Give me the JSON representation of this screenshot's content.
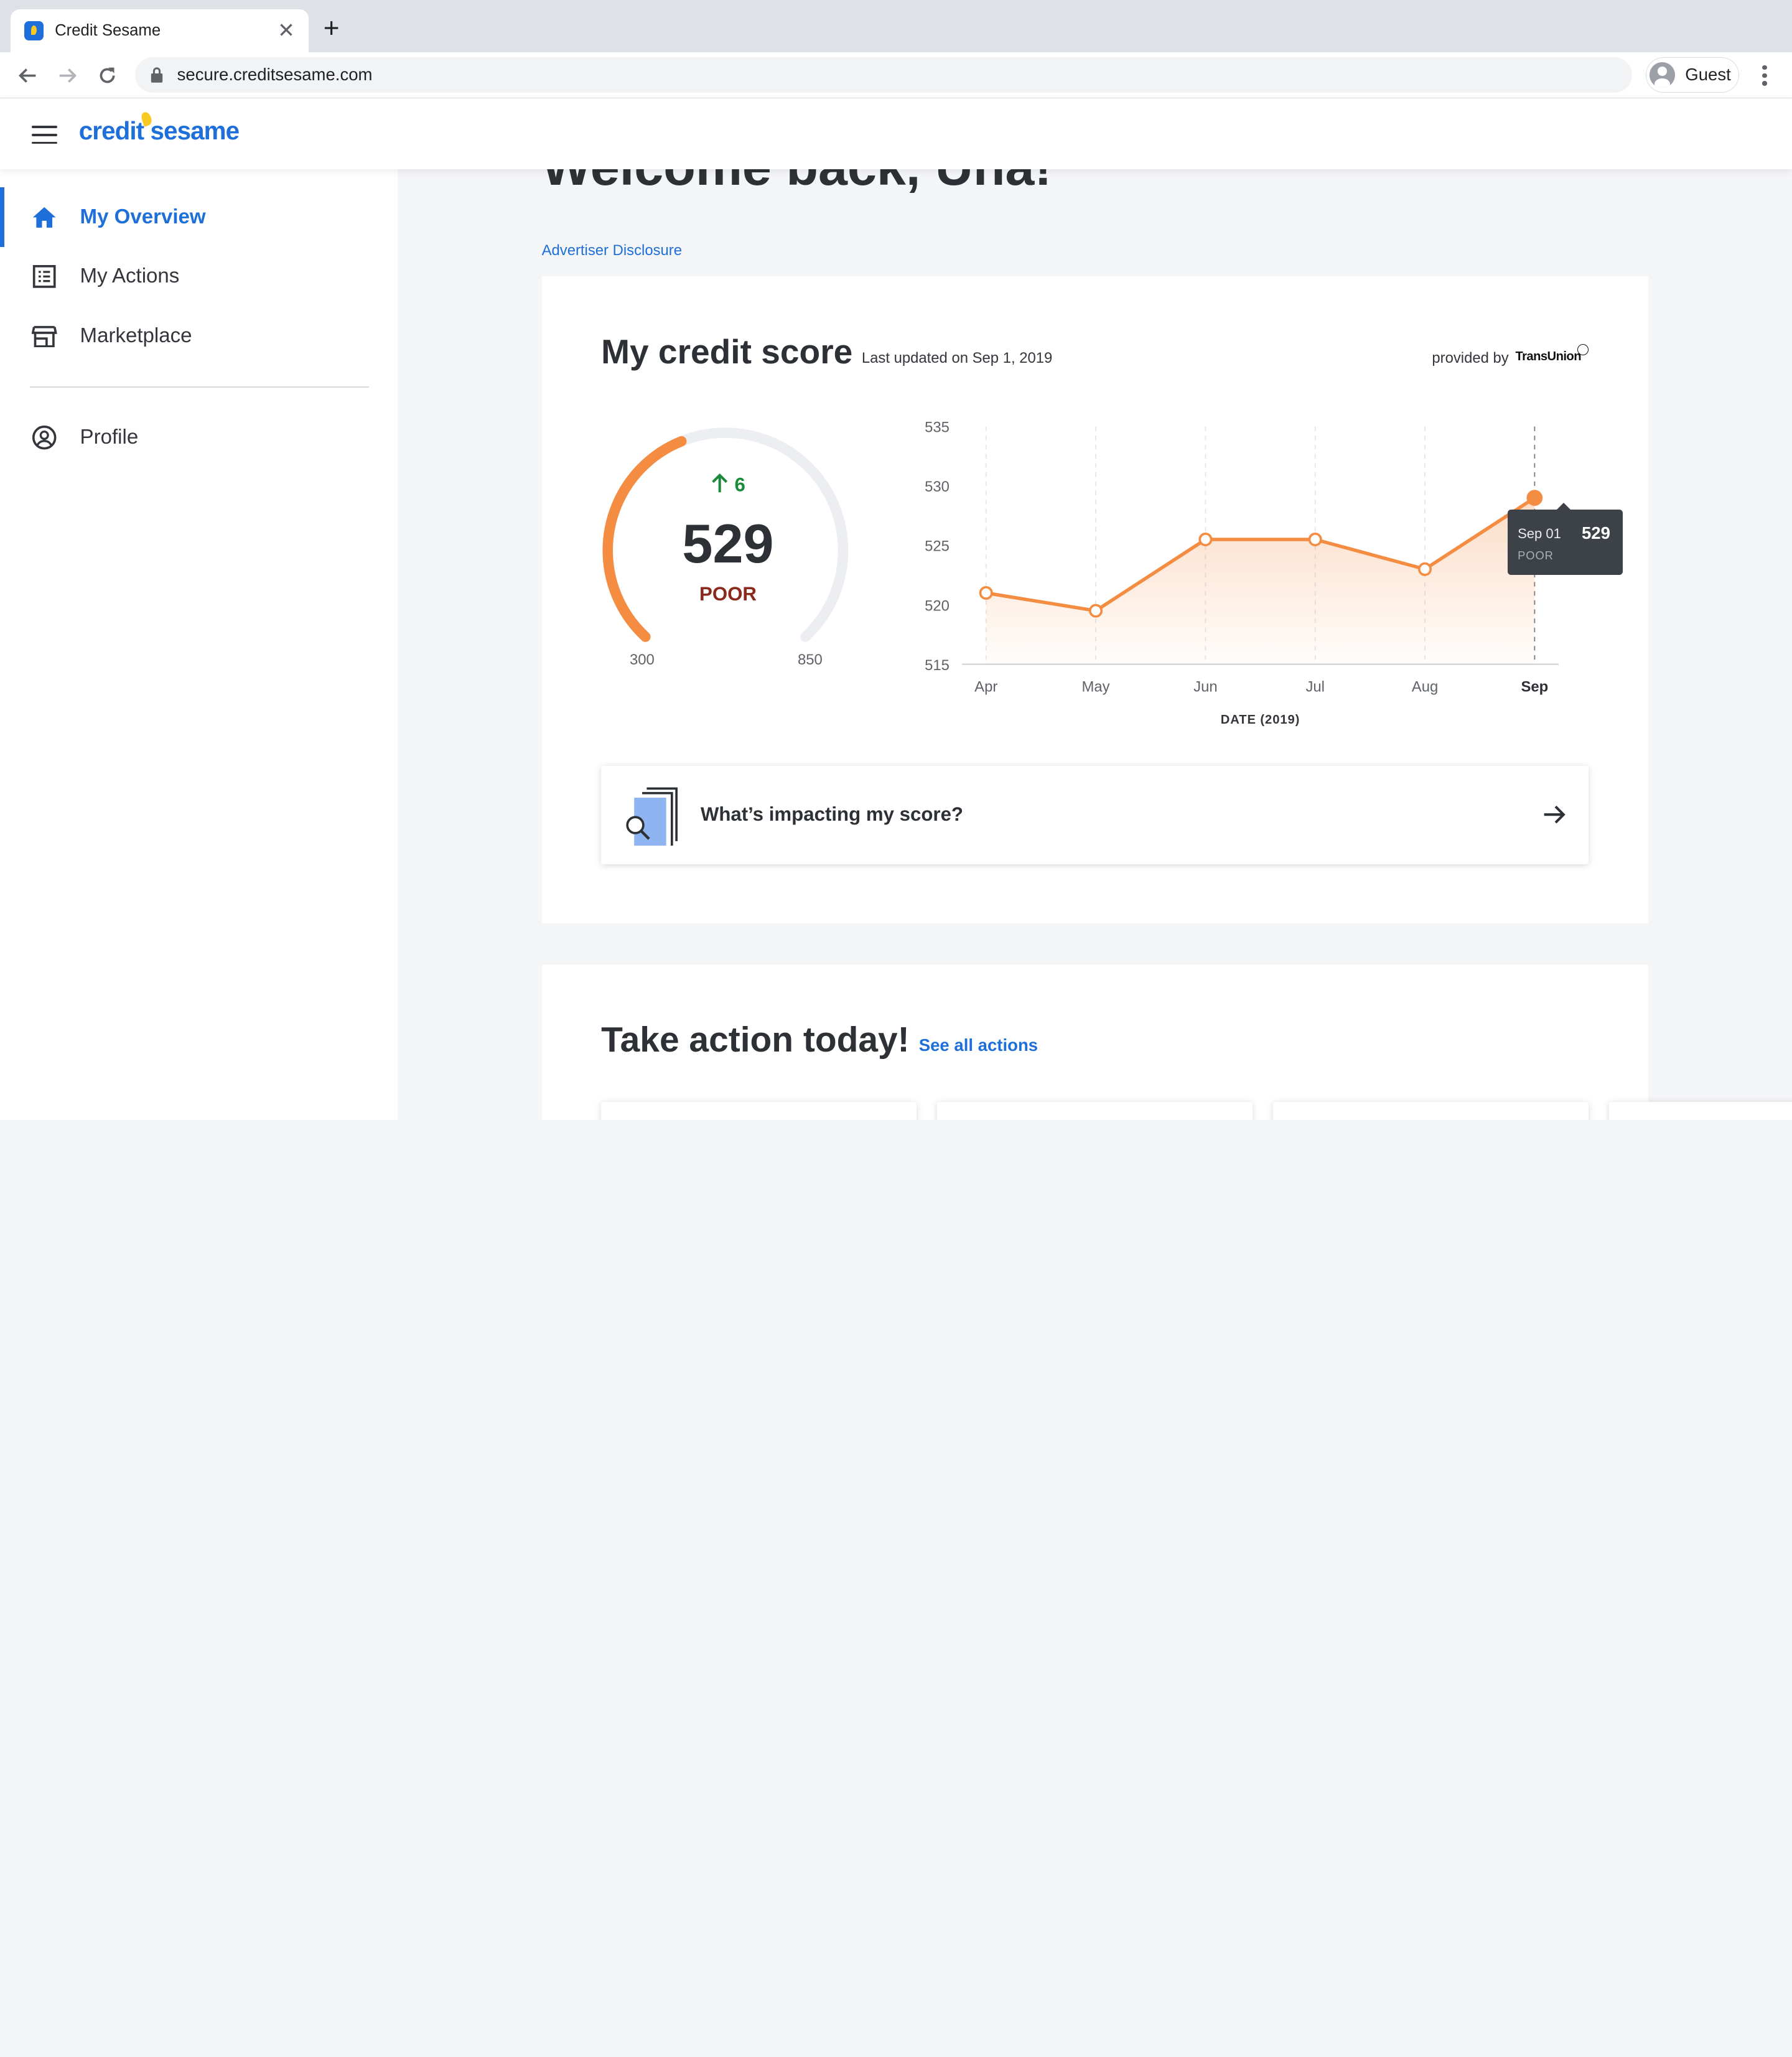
{
  "browser": {
    "tab_title": "Credit Sesame",
    "tab_close": "✕",
    "new_tab": "+",
    "url": "secure.creditsesame.com",
    "profile_label": "Guest"
  },
  "app": {
    "logo_text": "credit sesame",
    "brand_color": "#1e6fd9",
    "accent_color": "#f48c42"
  },
  "sidebar": {
    "items": [
      {
        "label": "My Overview",
        "icon": "home-icon",
        "active": true
      },
      {
        "label": "My Actions",
        "icon": "list-icon",
        "active": false
      },
      {
        "label": "Marketplace",
        "icon": "store-icon",
        "active": false
      },
      {
        "label": "Profile",
        "icon": "user-circle-icon",
        "active": false
      }
    ]
  },
  "main": {
    "welcome": "Welcome back, Una!",
    "advertiser_disclosure": "Advertiser Disclosure",
    "credit_score": {
      "title": "My credit score",
      "last_updated": "Last updated on Sep 1, 2019",
      "provided_by": "provided by",
      "provider": "TransUnion",
      "change": "6",
      "score": "529",
      "rating": "POOR",
      "min": "300",
      "max": "850",
      "gauge_fill_fraction": 0.42
    },
    "tooltip": {
      "date": "Sep 01",
      "value": "529",
      "rating": "POOR"
    },
    "impact": {
      "label": "What’s impacting my score?"
    },
    "take_action": {
      "title": "Take action today!",
      "link": "See all actions"
    }
  },
  "chart_data": {
    "type": "area",
    "categories": [
      "Apr",
      "May",
      "Jun",
      "Jul",
      "Aug",
      "Sep"
    ],
    "values": [
      521,
      519.5,
      525.5,
      525.5,
      523,
      529
    ],
    "ylim": [
      515,
      535
    ],
    "yticks": [
      535,
      530,
      525,
      520,
      515
    ],
    "xlabel": "DATE (2019)",
    "ylabel": "",
    "highlight_index": 5,
    "grid": "vertical-dashed",
    "color": "#f48c42"
  }
}
